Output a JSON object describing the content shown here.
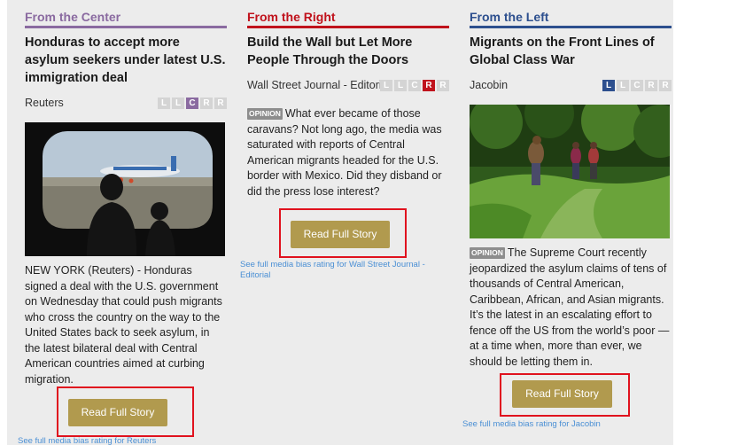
{
  "columns": {
    "center": {
      "heading": "From the Center",
      "headline": "Honduras to accept more asylum seekers under latest U.S. immigration deal",
      "source": "Reuters",
      "bias_letters": [
        "L",
        "L",
        "C",
        "R",
        "R"
      ],
      "body": "NEW YORK (Reuters) - Honduras signed a deal with the U.S. government on Wednesday that could push migrants who cross the country on the way to the United States back to seek asylum, in the latest bilateral deal with Central American countries aimed at curbing migration.",
      "button": "Read Full Story",
      "bias_link": "See full media bias rating for Reuters"
    },
    "right": {
      "heading": "From the Right",
      "headline": "Build the Wall but Let More People Through the Doors",
      "source": "Wall Street Journal - Editorial",
      "bias_letters": [
        "L",
        "L",
        "C",
        "R",
        "R"
      ],
      "opinion_tag": "OPINION",
      "body": "What ever became of those caravans? Not long ago, the media was saturated with reports of Central American migrants headed for the U.S. border with Mexico. Did they disband or did the press lose interest?",
      "button": "Read Full Story",
      "bias_link": "See full media bias rating for Wall Street Journal - Editorial"
    },
    "left": {
      "heading": "From the Left",
      "headline": "Migrants on the Front Lines of Global Class War",
      "source": "Jacobin",
      "bias_letters": [
        "L",
        "L",
        "C",
        "R",
        "R"
      ],
      "opinion_tag": "OPINION",
      "body": "The Supreme Court recently jeopardized the asylum claims of tens of thousands of Central American, Caribbean, African, and Asian migrants. It’s the latest in an escalating effort to fence off the US from the world’s poor — at a time when, more than ever, we should be letting them in.",
      "button": "Read Full Story",
      "bias_link": "See full media bias rating for Jacobin"
    }
  },
  "colors": {
    "center": "#8a6aa0",
    "right": "#c0121c",
    "left": "#2d4f8e",
    "button": "#b19a4e",
    "highlight_box": "#e0121e",
    "link": "#4a8fd4"
  }
}
